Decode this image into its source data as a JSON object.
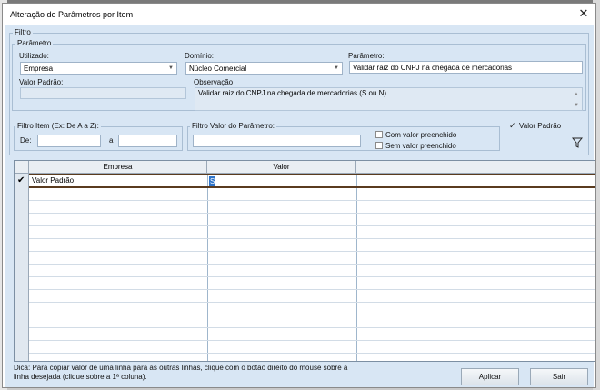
{
  "window": {
    "title": "Alteração de Parâmetros por Item",
    "close_glyph": "✕"
  },
  "filtro": {
    "label": "Filtro",
    "parametro_group": {
      "label": "Parâmetro",
      "utilizado": {
        "label": "Utilizado:",
        "value": "Empresa"
      },
      "dominio": {
        "label": "Domínio:",
        "value": "Núcleo Comercial"
      },
      "parametro": {
        "label": "Parâmetro:",
        "value": "Validar raiz do CNPJ na chegada de mercadorias"
      },
      "valor_padrao": {
        "label": "Valor Padrão:",
        "value": ""
      },
      "observacao": {
        "label": "Observação",
        "value": "Validar raiz do CNPJ na chegada de mercadorias (S ou N)."
      }
    },
    "filtro_item": {
      "label": "Filtro Item (Ex: De A a Z):",
      "de_label": "De:",
      "a_label": "a",
      "de_value": "",
      "a_value": ""
    },
    "filtro_valor": {
      "label": "Filtro Valor do Parâmetro:",
      "value": "",
      "com_valor": {
        "label": "Com valor preenchido",
        "checked": false
      },
      "sem_valor": {
        "label": "Sem valor preenchido",
        "checked": false
      }
    },
    "valor_padrao_check": {
      "label": "Valor Padrão",
      "checked": true,
      "glyph": "✓"
    },
    "filter_icon": "funnel-icon"
  },
  "grid": {
    "columns": [
      "Empresa",
      "Valor"
    ],
    "rows": [
      {
        "empresa": "Valor Padrão",
        "valor": "S",
        "checked": true,
        "check_glyph": "✔"
      }
    ]
  },
  "footer": {
    "hint": "Dica: Para copiar valor de uma linha para as outras linhas, clique com o botão direito do mouse sobre a linha desejada (clique sobre a 1ª coluna).",
    "apply_label": "Aplicar",
    "exit_label": "Sair"
  },
  "colors": {
    "client_bg": "#d8e6f4",
    "selection": "#2e73c8",
    "active_row_border": "#5a3b1f"
  }
}
